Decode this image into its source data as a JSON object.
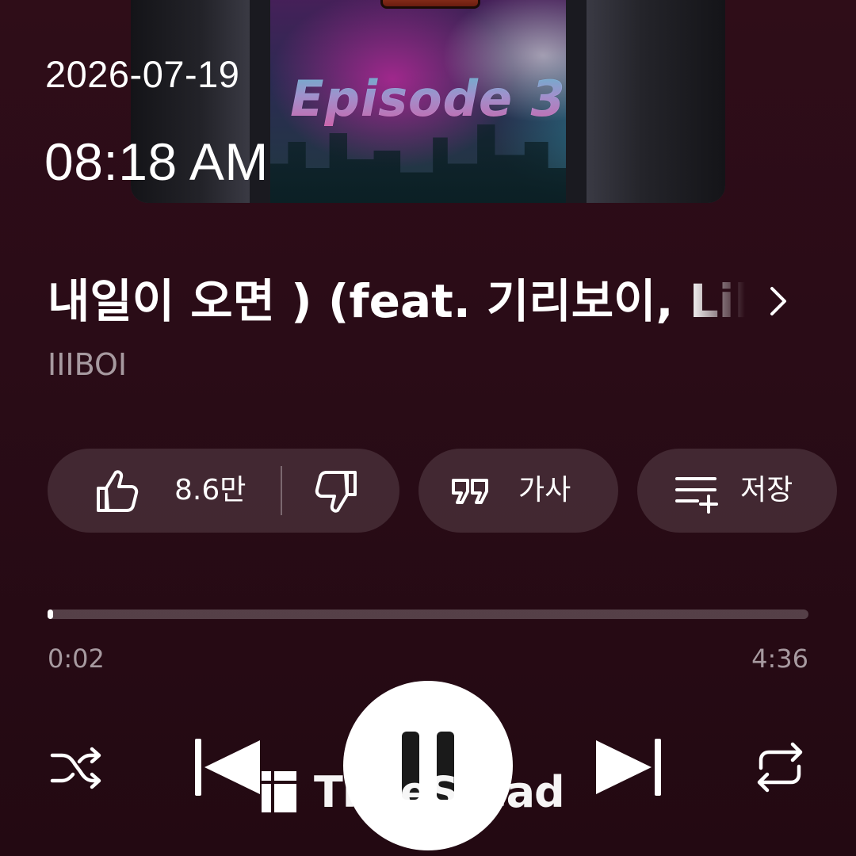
{
  "overlay": {
    "date": "2026-07-19",
    "time": "08:18 AM"
  },
  "album": {
    "art_text": "Episode 3"
  },
  "song": {
    "title": "내일이 오면 ) (feat. 기리보이, Lil Boi, BIG Naughty)",
    "artist": "IIIBOI"
  },
  "actions": {
    "like_count": "8.6만",
    "lyrics_label": "가사",
    "save_label": "저장"
  },
  "progress": {
    "elapsed": "0:02",
    "total": "4:36",
    "fraction": 0.007
  },
  "controls": {
    "state": "playing"
  },
  "watermark": {
    "text": "TimeStead"
  },
  "colors": {
    "background": "#2a0c17",
    "pill": "rgba(255,255,255,0.12)",
    "secondary_text": "#a79aa0",
    "primary_text": "#ffffff"
  }
}
